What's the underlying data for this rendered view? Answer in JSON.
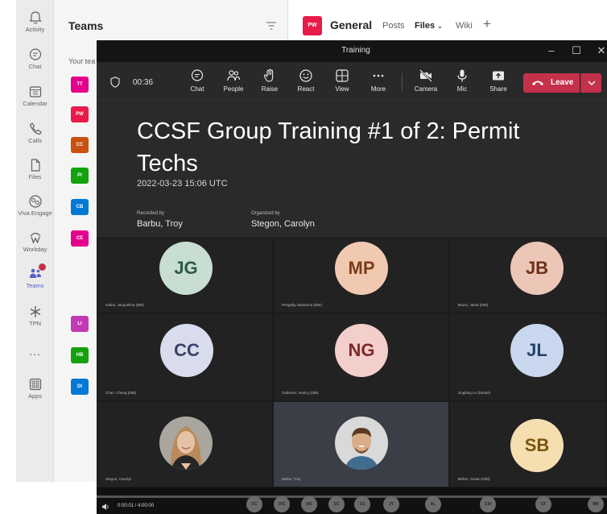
{
  "rail": {
    "items": [
      {
        "label": "Activity",
        "icon": "bell-icon"
      },
      {
        "label": "Chat",
        "icon": "chat-icon"
      },
      {
        "label": "Calendar",
        "icon": "calendar-icon"
      },
      {
        "label": "Calls",
        "icon": "phone-icon"
      },
      {
        "label": "Files",
        "icon": "file-icon"
      },
      {
        "label": "Viva Engage",
        "icon": "viva-engage-icon"
      },
      {
        "label": "Workday",
        "icon": "workday-icon"
      },
      {
        "label": "Teams",
        "icon": "teams-icon"
      },
      {
        "label": "TPN",
        "icon": "tpn-icon"
      },
      {
        "label": "...",
        "icon": "more-icon"
      },
      {
        "label": "Apps",
        "icon": "apps-icon"
      }
    ],
    "accent": "#5b5fc7"
  },
  "teams_panel": {
    "title": "Teams",
    "section": "Your tea",
    "tiles": [
      {
        "initials": "TT",
        "color": "#e3008c"
      },
      {
        "initials": "PW",
        "color": "#e81b4b"
      },
      {
        "initials": "CC",
        "color": "#ca5010"
      },
      {
        "initials": "PI",
        "color": "#13a10e"
      },
      {
        "initials": "CB",
        "color": "#0078d4"
      },
      {
        "initials": "CE",
        "color": "#e3008c"
      },
      {
        "initials": "LI",
        "color": "#c239b3"
      },
      {
        "initials": "HB",
        "color": "#13a10e"
      },
      {
        "initials": "DI",
        "color": "#0078d4"
      }
    ]
  },
  "channel": {
    "avatar": "PW",
    "name": "General",
    "tabs": [
      "Posts",
      "Files",
      "Wiki",
      "+"
    ]
  },
  "meeting": {
    "window_title": "Training",
    "timer": "00:36",
    "toolbar": [
      {
        "label": "Chat",
        "icon": "chat-icon"
      },
      {
        "label": "People",
        "icon": "people-icon"
      },
      {
        "label": "Raise",
        "icon": "raise-hand-icon"
      },
      {
        "label": "React",
        "icon": "smiley-icon"
      },
      {
        "label": "View",
        "icon": "grid-view-icon"
      },
      {
        "label": "More",
        "icon": "more-icon"
      },
      {
        "label": "Camera",
        "icon": "camera-off-icon"
      },
      {
        "label": "Mic",
        "icon": "mic-icon"
      },
      {
        "label": "Share",
        "icon": "share-icon"
      }
    ],
    "leave_label": "Leave",
    "leave_color": "#c4314b",
    "title": "CCSF Group Training #1 of 2: Permit Techs",
    "date": "2022-03-23 15:06 UTC",
    "recorded_by_label": "Recorded by",
    "recorded_by": "Barbu, Troy",
    "organized_by_label": "Organized by",
    "organized_by": "Stegon, Carolyn",
    "participants": [
      {
        "initials": "JG",
        "name": "Gabor, Jacqueline (DBI)",
        "bg": "#c8ded3",
        "fg": "#2f5b44"
      },
      {
        "initials": "MP",
        "name": "Pengelly, Marianna (DBI)",
        "bg": "#f1c9b1",
        "fg": "#7a3c1a"
      },
      {
        "initials": "JB",
        "name": "Bruno, Janet (DBI)",
        "bg": "#ecc7b8",
        "fg": "#6e2e1a"
      },
      {
        "initials": "CC",
        "name": "Chan, Cheng (DBI)",
        "bg": "#d9dcec",
        "fg": "#3b4266"
      },
      {
        "initials": "NG",
        "name": "Gutierrez, Nancy (DBI)",
        "bg": "#f3cfcc",
        "fg": "#7c2929"
      },
      {
        "initials": "JL",
        "name": "Jinglang Le (Daniel)",
        "bg": "#c9d8ee",
        "fg": "#25406b"
      },
      {
        "initials": "",
        "name": "Stegon, Carolyn",
        "bg": "#c9a27f",
        "fg": "#ffffff"
      },
      {
        "initials": "",
        "name": "Barbu, Troy",
        "bg": "#8a6b4f",
        "fg": "#ffffff"
      },
      {
        "initials": "SB",
        "name": "Bellon, Susan (DBI)",
        "bg": "#f5dfb0",
        "fg": "#7a5410"
      }
    ],
    "progress": 0.0,
    "time_readout": "0:00:01 / 4:00:00",
    "strip": [
      "DC",
      "WS",
      "MS",
      "SC",
      "SS",
      "JT",
      "AL",
      "CM",
      "CF",
      "MB"
    ]
  }
}
